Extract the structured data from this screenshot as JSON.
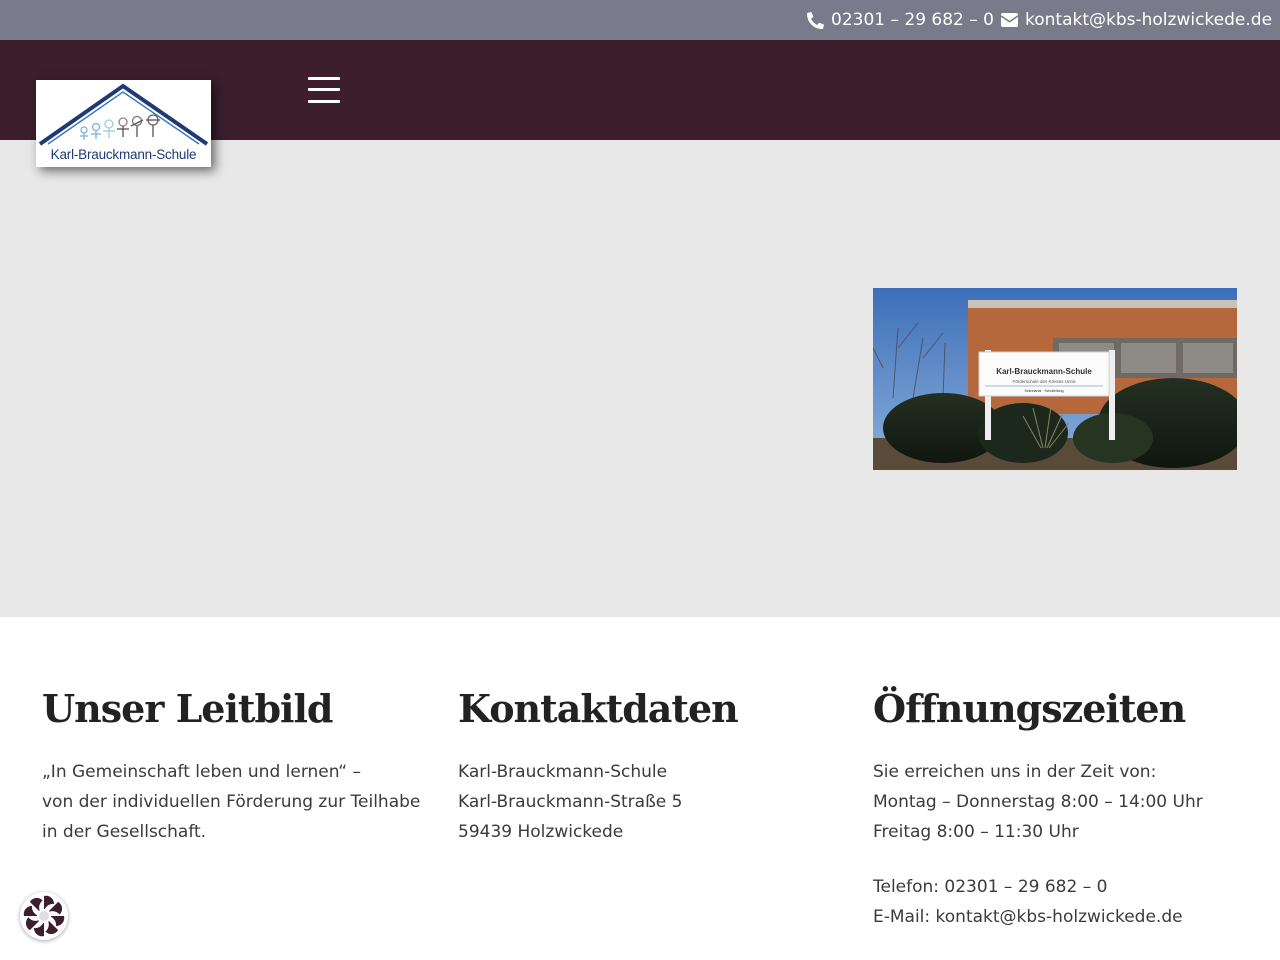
{
  "topbar": {
    "phone": "02301 – 29 682 – 0",
    "email": "kontakt@kbs-holzwickede.de"
  },
  "header": {
    "logo_text": "Karl-Brauckmann-Schule",
    "menu_icon": "hamburger-menu-icon"
  },
  "hero": {
    "photo_sign_title": "Karl-Brauckmann-Schule",
    "photo_sign_subtitle": "Förderschule des Kreises Unna",
    "photo_sign_footer": "Sekretariat · Schulleitung"
  },
  "footer": {
    "leitbild": {
      "title": "Unser Leitbild",
      "lines": [
        "„In Gemeinschaft leben und lernen“ –",
        "von der individuellen Förderung zur Teilhabe",
        "in der Gesellschaft."
      ]
    },
    "kontakt": {
      "title": "Kontaktdaten",
      "lines": [
        "Karl-Brauckmann-Schule",
        "Karl-Brauckmann-Straße 5",
        "59439 Holzwickede"
      ]
    },
    "zeiten": {
      "title": "Öffnungszeiten",
      "lines": [
        "Sie erreichen uns in der Zeit von:",
        "Montag – Donnerstag 8:00 – 14:00 Uhr",
        "Freitag 8:00 – 11:30 Uhr"
      ],
      "contact_lines": [
        "Telefon: 02301 – 29 682 – 0",
        "E-Mail: kontakt@kbs-holzwickede.de"
      ]
    }
  },
  "colors": {
    "topbar": "#797a8a",
    "header": "#3c1e2d",
    "hero": "#e8e8e8",
    "logo_blue": "#1d3a77"
  },
  "widget": {
    "icon": "cookie-consent-icon"
  }
}
